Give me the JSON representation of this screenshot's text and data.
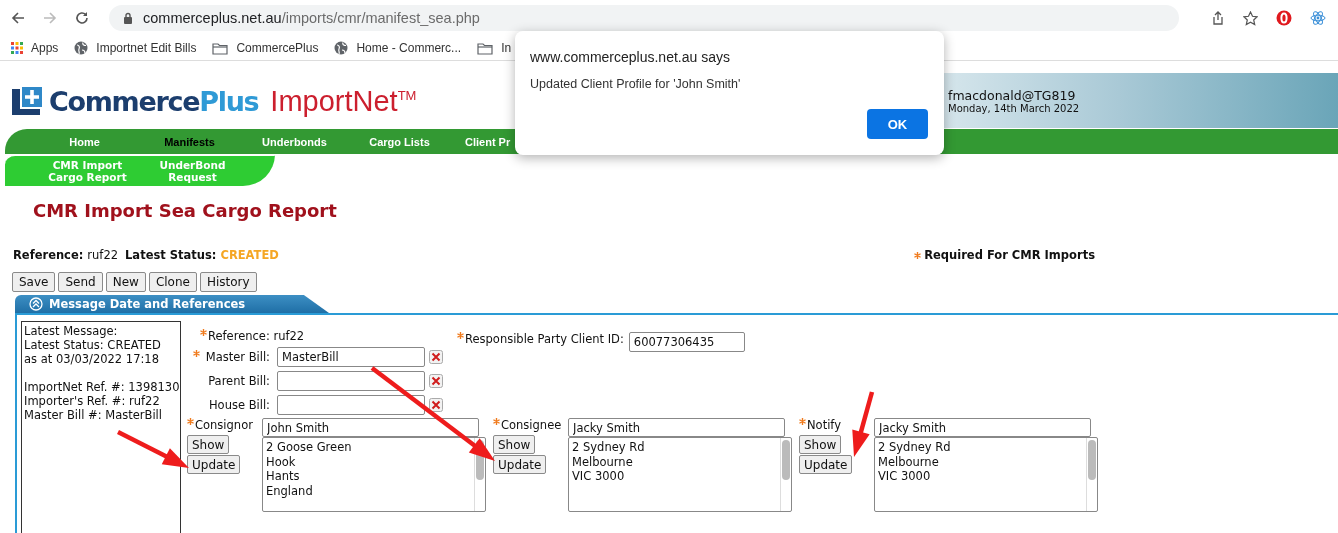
{
  "browser": {
    "url_host": "commerceplus.net.au",
    "url_path": "/imports/cmr/manifest_sea.php",
    "forward_disabled": true,
    "bookmarks": [
      {
        "kind": "apps",
        "label": "Apps"
      },
      {
        "kind": "globe",
        "label": "Importnet Edit Bills"
      },
      {
        "kind": "folder",
        "label": "CommercePlus"
      },
      {
        "kind": "globe",
        "label": "Home - Commerc..."
      },
      {
        "kind": "folder",
        "label": "In"
      }
    ]
  },
  "header": {
    "brand_main": "Commerce",
    "brand_accent": "Plus",
    "product": "ImportNet$^{TM}$",
    "user": "fmacdonald@TG819",
    "date": "Monday, 14th March 2022"
  },
  "nav": [
    {
      "label": "Home",
      "selected": false
    },
    {
      "label": "Manifests",
      "selected": true
    },
    {
      "label": "Underbonds",
      "selected": false
    },
    {
      "label": "Cargo Lists",
      "selected": false
    },
    {
      "label": "Client Pr",
      "selected": false
    }
  ],
  "subnav": [
    {
      "label": "CMR Import\nCargo Report"
    },
    {
      "label": "UnderBond\nRequest"
    }
  ],
  "page_title": "CMR Import Sea Cargo Report",
  "status": {
    "reference_label": "Reference:",
    "reference": "ruf22",
    "status_label": "Latest Status:",
    "status": "CREATED"
  },
  "required_note": {
    "required": true,
    "text": "Required For CMR Imports"
  },
  "toolbar": [
    "Save",
    "Send",
    "New",
    "Clone",
    "History"
  ],
  "section": {
    "title": "Message Date and References",
    "expanded": true,
    "info_box": [
      [
        "Latest Message:",
        "Latest Status: CREATED",
        "as at 03/03/2022 17:18"
      ],
      [
        "ImportNet Ref. #: 1398130",
        "Importer's Ref. #: ruf22",
        "Master Bill #: MasterBill"
      ]
    ],
    "reference": {
      "label": "Reference: ruf22",
      "required": true
    },
    "bills": [
      {
        "label": "Master Bill:",
        "value": "MasterBill",
        "required": true
      },
      {
        "label": "Parent Bill:",
        "required": false
      },
      {
        "label": "House Bill:",
        "required": false
      }
    ],
    "responsible": {
      "label": "Responsible Party Client ID:",
      "value": "60077306435",
      "required": true
    },
    "parties": [
      {
        "label": "Consignor",
        "required": true,
        "name": "John Smith",
        "address": [
          "2 Goose Green",
          "Hook",
          "Hants",
          "England"
        ],
        "show": "Show",
        "update": "Update"
      },
      {
        "label": "Consignee",
        "required": true,
        "name": "Jacky Smith",
        "address": [
          "2 Sydney Rd",
          "Melbourne",
          "VIC 3000"
        ],
        "show": "Show",
        "update": "Update"
      },
      {
        "label": "Notify",
        "required": true,
        "name": "Jacky Smith",
        "address": [
          "2 Sydney Rd",
          "Melbourne",
          "VIC 3000"
        ],
        "show": "Show",
        "update": "Update"
      }
    ]
  },
  "dialog": {
    "origin": "www.commerceplus.net.au says",
    "message": "Updated Client Profile for 'John Smith'",
    "button": "OK"
  },
  "annotations": [
    {
      "kind": "arrow"
    },
    {
      "kind": "arrow"
    },
    {
      "kind": "arrow"
    }
  ]
}
